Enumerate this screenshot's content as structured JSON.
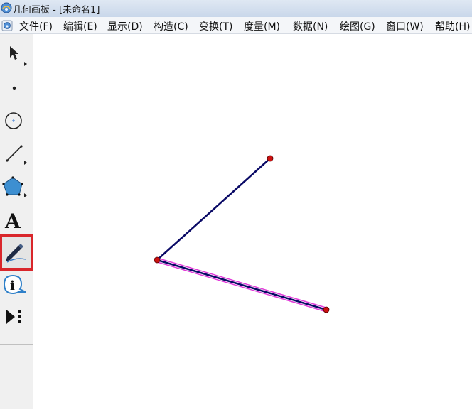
{
  "window": {
    "app_name": "几何画板",
    "separator": " - ",
    "document": "[未命名1]"
  },
  "menu": [
    {
      "id": "file",
      "label": "文件(F)"
    },
    {
      "id": "edit",
      "label": "编辑(E)"
    },
    {
      "id": "display",
      "label": "显示(D)"
    },
    {
      "id": "construct",
      "label": "构造(C)"
    },
    {
      "id": "transform",
      "label": "变换(T)"
    },
    {
      "id": "measure",
      "label": "度量(M)"
    },
    {
      "id": "data",
      "label": "数据(N)"
    },
    {
      "id": "graph",
      "label": "绘图(G)"
    },
    {
      "id": "window",
      "label": "窗口(W)"
    },
    {
      "id": "help",
      "label": "帮助(H)"
    }
  ],
  "toolbar": {
    "tools": [
      {
        "name": "arrow-tool",
        "icon": "arrow-icon"
      },
      {
        "name": "point-tool",
        "icon": "point-icon"
      },
      {
        "name": "compass-tool",
        "icon": "circle-icon"
      },
      {
        "name": "straightedge-tool",
        "icon": "segment-icon"
      },
      {
        "name": "polygon-tool",
        "icon": "polygon-icon"
      },
      {
        "name": "text-tool",
        "icon": "text-icon",
        "glyph": "A"
      },
      {
        "name": "marker-tool",
        "icon": "marker-pen-icon",
        "active": true
      },
      {
        "name": "information-tool",
        "icon": "info-icon",
        "glyph": "i"
      },
      {
        "name": "custom-tool",
        "icon": "custom-tool-icon"
      }
    ]
  },
  "canvas": {
    "points": [
      {
        "name": "point-a",
        "color": "#cc1111"
      },
      {
        "name": "point-b",
        "color": "#cc1111"
      },
      {
        "name": "point-c",
        "color": "#cc1111"
      }
    ],
    "segments": [
      {
        "name": "segment-ba",
        "color": "#0a0a66",
        "selected": false
      },
      {
        "name": "segment-bc",
        "color": "#0a0a66",
        "selected": true,
        "highlight_color": "#e23ad8"
      }
    ]
  }
}
